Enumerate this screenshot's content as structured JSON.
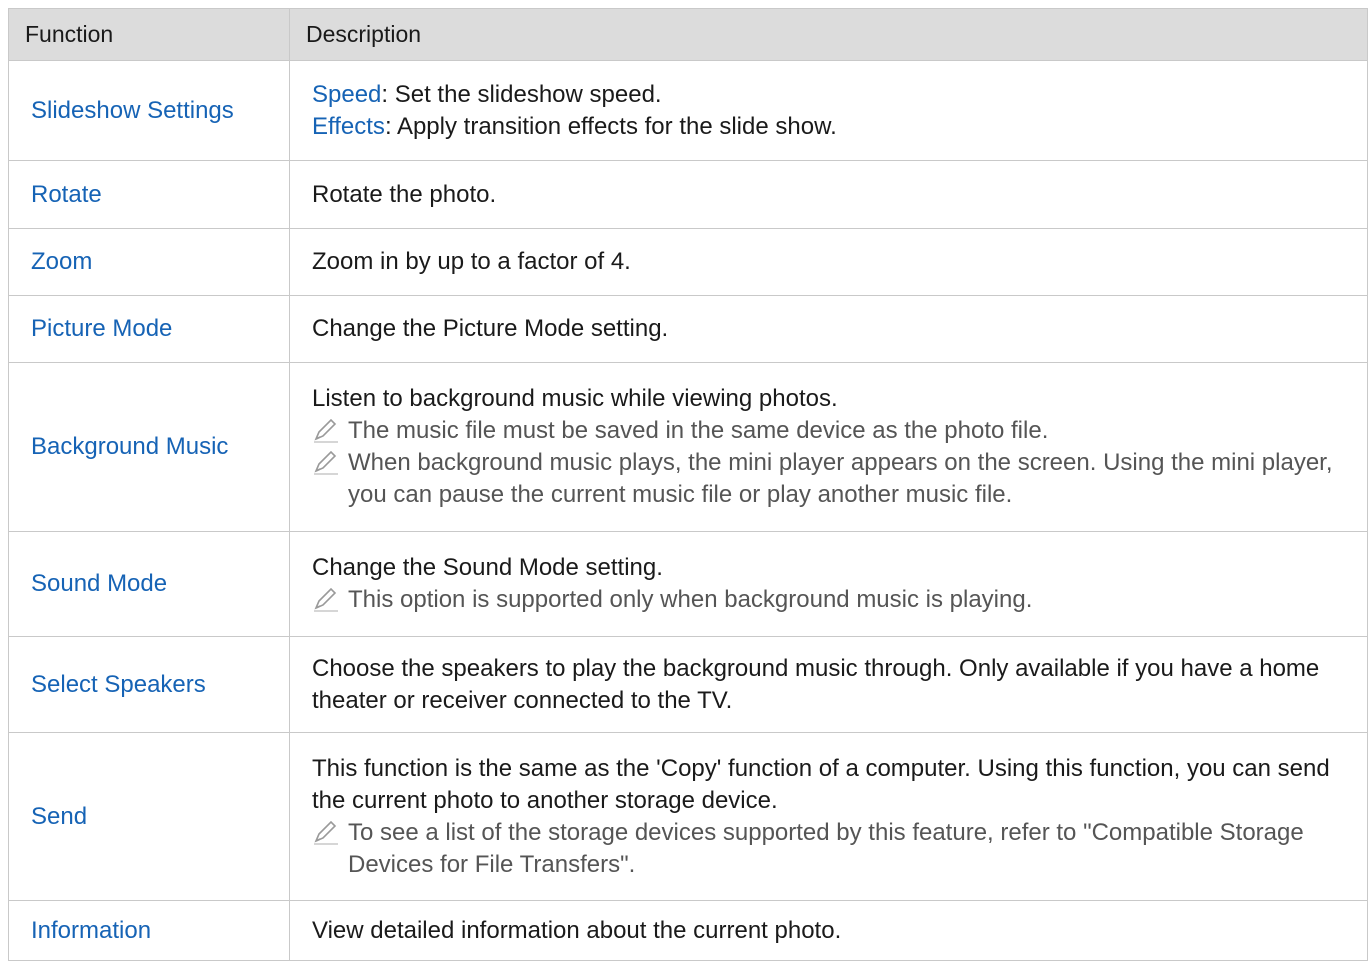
{
  "header": {
    "function": "Function",
    "description": "Description"
  },
  "rows": [
    {
      "function": "Slideshow Settings",
      "items": [
        {
          "term": "Speed",
          "text": ": Set the slideshow speed."
        },
        {
          "term": "Effects",
          "text": ": Apply transition effects for the slide show."
        }
      ]
    },
    {
      "function": "Rotate",
      "text": "Rotate the photo."
    },
    {
      "function": "Zoom",
      "text": "Zoom in by up to a factor of 4."
    },
    {
      "function": "Picture Mode",
      "text": "Change the Picture Mode setting."
    },
    {
      "function": "Background Music",
      "text": "Listen to background music while viewing photos.",
      "notes": [
        "The music file must be saved in the same device as the photo file.",
        "When background music plays, the mini player appears on the screen. Using the mini player, you can pause the current music file or play another music file."
      ]
    },
    {
      "function": "Sound Mode",
      "text": "Change the Sound Mode setting.",
      "notes": [
        "This option is supported only when background music is playing."
      ]
    },
    {
      "function": "Select Speakers",
      "text": "Choose the speakers to play the background music through. Only available if you have a home theater or receiver connected to the TV."
    },
    {
      "function": "Send",
      "text": "This function is the same as the 'Copy' function of a computer. Using this function, you can send the current photo to another storage device.",
      "notes": [
        "To see a list of the storage devices supported by this feature, refer to \"Compatible Storage Devices for File Transfers\"."
      ]
    },
    {
      "function": "Information",
      "text": "View detailed information about the current photo."
    }
  ],
  "icons": {
    "note": "pencil-note-icon"
  },
  "colors": {
    "header_bg": "#dcdcdc",
    "link_blue": "#1663b5",
    "note_gray": "#555555",
    "border": "#c9c9c9"
  }
}
